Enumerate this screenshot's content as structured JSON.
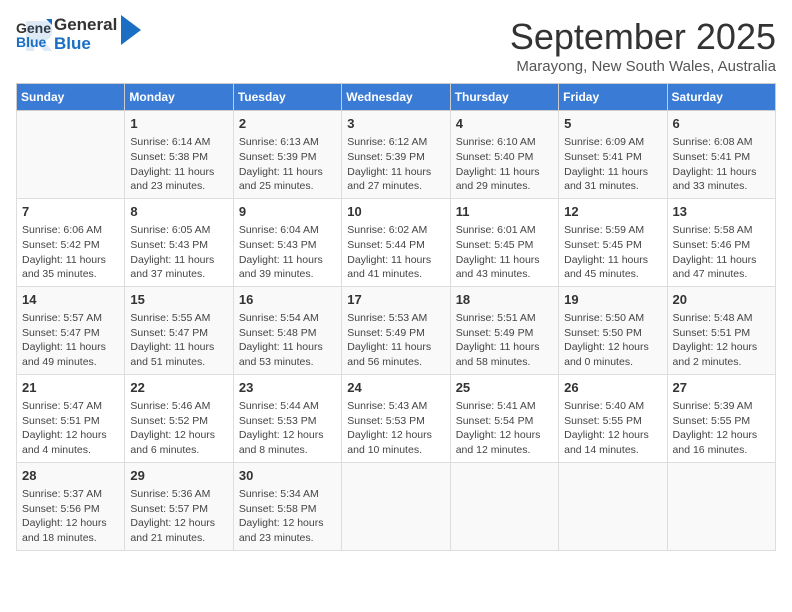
{
  "header": {
    "logo_general": "General",
    "logo_blue": "Blue",
    "title": "September 2025",
    "location": "Marayong, New South Wales, Australia"
  },
  "days_of_week": [
    "Sunday",
    "Monday",
    "Tuesday",
    "Wednesday",
    "Thursday",
    "Friday",
    "Saturday"
  ],
  "weeks": [
    [
      {
        "day": "",
        "sunrise": "",
        "sunset": "",
        "daylight": ""
      },
      {
        "day": "1",
        "sunrise": "Sunrise: 6:14 AM",
        "sunset": "Sunset: 5:38 PM",
        "daylight": "Daylight: 11 hours and 23 minutes."
      },
      {
        "day": "2",
        "sunrise": "Sunrise: 6:13 AM",
        "sunset": "Sunset: 5:39 PM",
        "daylight": "Daylight: 11 hours and 25 minutes."
      },
      {
        "day": "3",
        "sunrise": "Sunrise: 6:12 AM",
        "sunset": "Sunset: 5:39 PM",
        "daylight": "Daylight: 11 hours and 27 minutes."
      },
      {
        "day": "4",
        "sunrise": "Sunrise: 6:10 AM",
        "sunset": "Sunset: 5:40 PM",
        "daylight": "Daylight: 11 hours and 29 minutes."
      },
      {
        "day": "5",
        "sunrise": "Sunrise: 6:09 AM",
        "sunset": "Sunset: 5:41 PM",
        "daylight": "Daylight: 11 hours and 31 minutes."
      },
      {
        "day": "6",
        "sunrise": "Sunrise: 6:08 AM",
        "sunset": "Sunset: 5:41 PM",
        "daylight": "Daylight: 11 hours and 33 minutes."
      }
    ],
    [
      {
        "day": "7",
        "sunrise": "Sunrise: 6:06 AM",
        "sunset": "Sunset: 5:42 PM",
        "daylight": "Daylight: 11 hours and 35 minutes."
      },
      {
        "day": "8",
        "sunrise": "Sunrise: 6:05 AM",
        "sunset": "Sunset: 5:43 PM",
        "daylight": "Daylight: 11 hours and 37 minutes."
      },
      {
        "day": "9",
        "sunrise": "Sunrise: 6:04 AM",
        "sunset": "Sunset: 5:43 PM",
        "daylight": "Daylight: 11 hours and 39 minutes."
      },
      {
        "day": "10",
        "sunrise": "Sunrise: 6:02 AM",
        "sunset": "Sunset: 5:44 PM",
        "daylight": "Daylight: 11 hours and 41 minutes."
      },
      {
        "day": "11",
        "sunrise": "Sunrise: 6:01 AM",
        "sunset": "Sunset: 5:45 PM",
        "daylight": "Daylight: 11 hours and 43 minutes."
      },
      {
        "day": "12",
        "sunrise": "Sunrise: 5:59 AM",
        "sunset": "Sunset: 5:45 PM",
        "daylight": "Daylight: 11 hours and 45 minutes."
      },
      {
        "day": "13",
        "sunrise": "Sunrise: 5:58 AM",
        "sunset": "Sunset: 5:46 PM",
        "daylight": "Daylight: 11 hours and 47 minutes."
      }
    ],
    [
      {
        "day": "14",
        "sunrise": "Sunrise: 5:57 AM",
        "sunset": "Sunset: 5:47 PM",
        "daylight": "Daylight: 11 hours and 49 minutes."
      },
      {
        "day": "15",
        "sunrise": "Sunrise: 5:55 AM",
        "sunset": "Sunset: 5:47 PM",
        "daylight": "Daylight: 11 hours and 51 minutes."
      },
      {
        "day": "16",
        "sunrise": "Sunrise: 5:54 AM",
        "sunset": "Sunset: 5:48 PM",
        "daylight": "Daylight: 11 hours and 53 minutes."
      },
      {
        "day": "17",
        "sunrise": "Sunrise: 5:53 AM",
        "sunset": "Sunset: 5:49 PM",
        "daylight": "Daylight: 11 hours and 56 minutes."
      },
      {
        "day": "18",
        "sunrise": "Sunrise: 5:51 AM",
        "sunset": "Sunset: 5:49 PM",
        "daylight": "Daylight: 11 hours and 58 minutes."
      },
      {
        "day": "19",
        "sunrise": "Sunrise: 5:50 AM",
        "sunset": "Sunset: 5:50 PM",
        "daylight": "Daylight: 12 hours and 0 minutes."
      },
      {
        "day": "20",
        "sunrise": "Sunrise: 5:48 AM",
        "sunset": "Sunset: 5:51 PM",
        "daylight": "Daylight: 12 hours and 2 minutes."
      }
    ],
    [
      {
        "day": "21",
        "sunrise": "Sunrise: 5:47 AM",
        "sunset": "Sunset: 5:51 PM",
        "daylight": "Daylight: 12 hours and 4 minutes."
      },
      {
        "day": "22",
        "sunrise": "Sunrise: 5:46 AM",
        "sunset": "Sunset: 5:52 PM",
        "daylight": "Daylight: 12 hours and 6 minutes."
      },
      {
        "day": "23",
        "sunrise": "Sunrise: 5:44 AM",
        "sunset": "Sunset: 5:53 PM",
        "daylight": "Daylight: 12 hours and 8 minutes."
      },
      {
        "day": "24",
        "sunrise": "Sunrise: 5:43 AM",
        "sunset": "Sunset: 5:53 PM",
        "daylight": "Daylight: 12 hours and 10 minutes."
      },
      {
        "day": "25",
        "sunrise": "Sunrise: 5:41 AM",
        "sunset": "Sunset: 5:54 PM",
        "daylight": "Daylight: 12 hours and 12 minutes."
      },
      {
        "day": "26",
        "sunrise": "Sunrise: 5:40 AM",
        "sunset": "Sunset: 5:55 PM",
        "daylight": "Daylight: 12 hours and 14 minutes."
      },
      {
        "day": "27",
        "sunrise": "Sunrise: 5:39 AM",
        "sunset": "Sunset: 5:55 PM",
        "daylight": "Daylight: 12 hours and 16 minutes."
      }
    ],
    [
      {
        "day": "28",
        "sunrise": "Sunrise: 5:37 AM",
        "sunset": "Sunset: 5:56 PM",
        "daylight": "Daylight: 12 hours and 18 minutes."
      },
      {
        "day": "29",
        "sunrise": "Sunrise: 5:36 AM",
        "sunset": "Sunset: 5:57 PM",
        "daylight": "Daylight: 12 hours and 21 minutes."
      },
      {
        "day": "30",
        "sunrise": "Sunrise: 5:34 AM",
        "sunset": "Sunset: 5:58 PM",
        "daylight": "Daylight: 12 hours and 23 minutes."
      },
      {
        "day": "",
        "sunrise": "",
        "sunset": "",
        "daylight": ""
      },
      {
        "day": "",
        "sunrise": "",
        "sunset": "",
        "daylight": ""
      },
      {
        "day": "",
        "sunrise": "",
        "sunset": "",
        "daylight": ""
      },
      {
        "day": "",
        "sunrise": "",
        "sunset": "",
        "daylight": ""
      }
    ]
  ]
}
